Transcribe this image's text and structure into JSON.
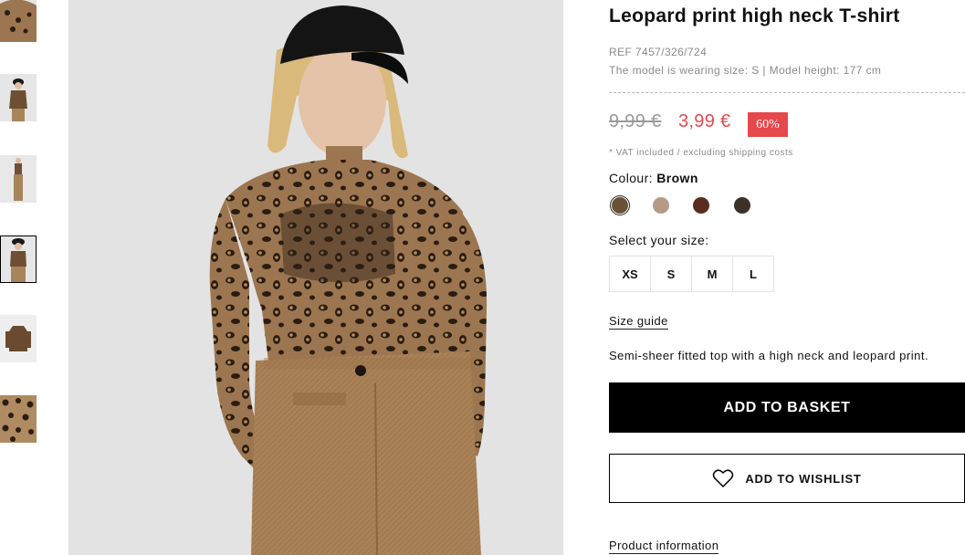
{
  "product": {
    "title": "Leopard print high neck T-shirt",
    "ref": "REF 7457/326/724",
    "model_info": "The model is wearing size: S | Model height: 177 cm",
    "price_old": "9,99 €",
    "price_new": "3,99 €",
    "discount": "60%",
    "vat_note": "* VAT included / excluding shipping costs",
    "colour_label": "Colour:",
    "colour_value": "Brown",
    "size_label": "Select your size:",
    "sizes": [
      "XS",
      "S",
      "M",
      "L"
    ],
    "size_guide": "Size guide",
    "description": "Semi-sheer fitted top with a high neck and leopard print.",
    "add_to_basket": "ADD TO BASKET",
    "add_to_wishlist": "ADD TO WISHLIST",
    "product_information": "Product information"
  },
  "colour_swatches": [
    {
      "name": "leopard-brown",
      "color": "#6b5236",
      "selected": true
    },
    {
      "name": "leopard-beige",
      "color": "#b69a86",
      "selected": false
    },
    {
      "name": "leopard-rust",
      "color": "#5a2c20",
      "selected": false
    },
    {
      "name": "leopard-dark",
      "color": "#3c3129",
      "selected": false
    }
  ],
  "thumbnails": [
    {
      "name": "thumb-leopard-detail",
      "selected": false
    },
    {
      "name": "thumb-model-front",
      "selected": false
    },
    {
      "name": "thumb-model-full",
      "selected": false
    },
    {
      "name": "thumb-model-crop",
      "selected": true
    },
    {
      "name": "thumb-garment-flat",
      "selected": false
    },
    {
      "name": "thumb-fabric-closeup",
      "selected": false
    }
  ],
  "colors": {
    "sale_red": "#e5484d",
    "muted_grey": "#8a8a8a"
  }
}
